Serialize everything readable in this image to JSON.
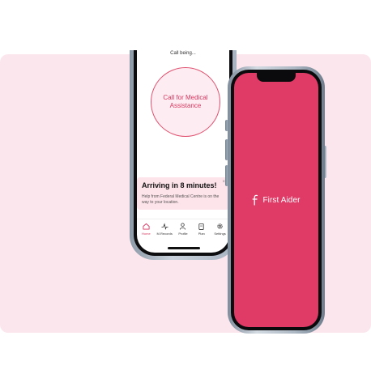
{
  "back_screen": {
    "top_text": "Call being...",
    "call_button": {
      "line1": "Call for Medical",
      "line2": "Assistance"
    },
    "arrival_card": {
      "title": "Arriving in 8 minutes!",
      "body": "Help from Federal Medical Centre is on the way to your location.",
      "close": "×"
    },
    "tabs": [
      {
        "label": "Home",
        "icon": "home-icon"
      },
      {
        "label": "M.Records",
        "icon": "heartbeat-icon"
      },
      {
        "label": "Profile",
        "icon": "user-icon"
      },
      {
        "label": "Plan",
        "icon": "clipboard-icon"
      },
      {
        "label": "Settings",
        "icon": "gear-icon"
      }
    ]
  },
  "front_screen": {
    "app_name": "First Aider",
    "background_color": "#e03a66"
  },
  "colors": {
    "backdrop": "#fae6ec",
    "accent": "#d93861",
    "card_bg": "#fde3ea"
  }
}
